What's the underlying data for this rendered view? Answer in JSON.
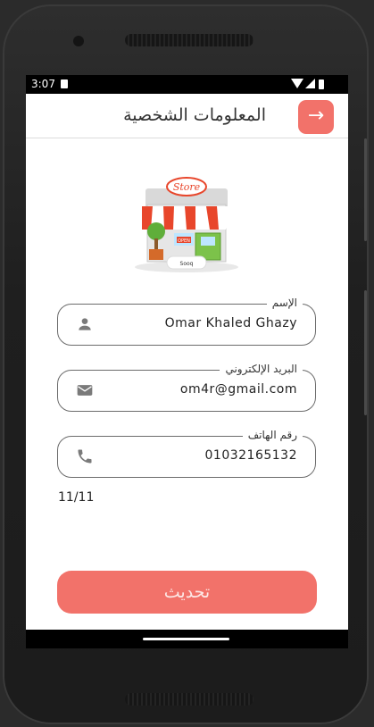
{
  "status_bar": {
    "time": "3:07"
  },
  "app_bar": {
    "title": "المعلومات الشخصية",
    "back_icon": "arrow-forward-icon"
  },
  "store_logo": {
    "sign_text": "Store",
    "banner_text": "OPEN",
    "base_text": "Sooq"
  },
  "form": {
    "name": {
      "label": "الإسم",
      "value": "Omar Khaled Ghazy",
      "icon": "person-icon"
    },
    "email": {
      "label": "البريد الإلكتروني",
      "value": "om4r@gmail.com",
      "icon": "mail-icon"
    },
    "phone": {
      "label": "رقم الهاتف",
      "value": "01032165132",
      "icon": "phone-icon"
    },
    "counter": "11/11"
  },
  "submit_label": "تحديث",
  "colors": {
    "accent": "#f2726a",
    "text": "#222222",
    "icon_gray": "#7a7a7a"
  }
}
